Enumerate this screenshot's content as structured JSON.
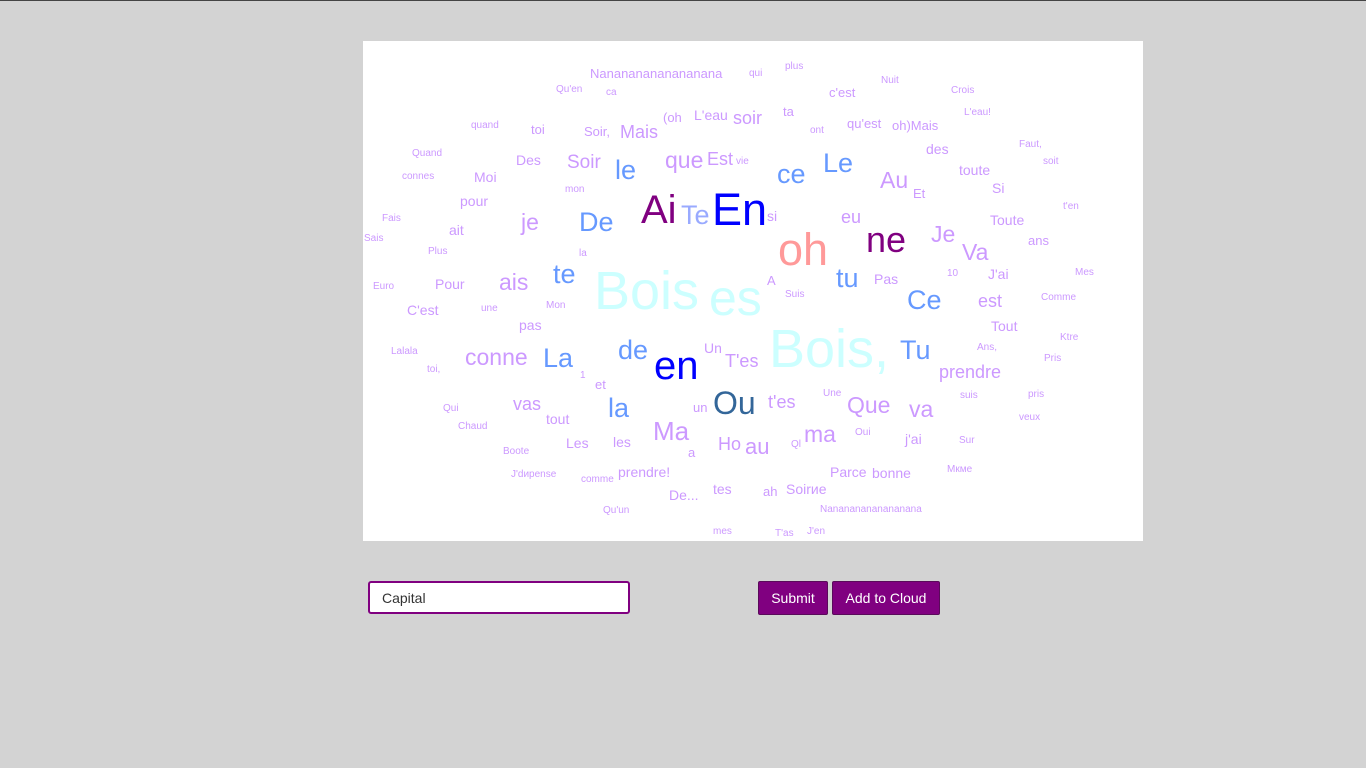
{
  "controls": {
    "input_value": "Capital",
    "submit_label": "Submit",
    "add_label": "Add to Cloud"
  },
  "colors": {
    "page_background": "#d3d3d3",
    "cloud_background": "#ffffff",
    "button_color": "#800080"
  },
  "words": [
    "Nanananananananana",
    "qui",
    "plus",
    "Qu'en",
    "ca",
    "c'est",
    "Nuit",
    "Crois",
    "(oh",
    "L'eau",
    "soir",
    "ta",
    "qu'est",
    "oh)Mais",
    "L'eau!",
    "quand",
    "toi",
    "Soir,",
    "Mais",
    "ont",
    "Faut,",
    "Quand",
    "Des",
    "Soir",
    "que",
    "Est",
    "vie",
    "des",
    "toute",
    "soit",
    "connes",
    "Moi",
    "le",
    "ce",
    "Le",
    "Au",
    "Et",
    "Si",
    "mon",
    "pour",
    "Ai",
    "Te",
    "En",
    "t'en",
    "Fais",
    "ait",
    "je",
    "De",
    "si",
    "eu",
    "Toute",
    "Sais",
    "Plus",
    "la",
    "oh",
    "ne",
    "Je",
    "ans",
    "Va",
    "te",
    "Bois",
    "es",
    "tu",
    "J'ai",
    "Euro",
    "Pour",
    "ais",
    "A",
    "Pas",
    "10",
    "Mes",
    "C'est",
    "une",
    "Mon",
    "Suis",
    "Ce",
    "est",
    "Comme",
    "pas",
    "Tout",
    "Ktre",
    "Lalala",
    "conne",
    "La",
    "de",
    "en",
    "Un",
    "T'es",
    "Bois,",
    "Tu",
    "Ans,",
    "Pris",
    "toi,",
    "1",
    "et",
    "prendre",
    "Qui",
    "vas",
    "la",
    "un",
    "Ou",
    "t'es",
    "Une",
    "Que",
    "va",
    "suis",
    "pris",
    "Chaud",
    "tout",
    "veux",
    "Ma",
    "ma",
    "Oui",
    "j'ai",
    "Les",
    "les",
    "Ho",
    "au",
    "Ql",
    "Sur",
    "Boote",
    "a",
    "J'dиpense",
    "prendre!",
    "Parce",
    "bonne",
    "Мкме",
    "comme",
    "De...",
    "tes",
    "ah",
    "Soirиe",
    "Qu'un",
    "Nanananananananana",
    "mes",
    "T'as",
    "J'en"
  ]
}
